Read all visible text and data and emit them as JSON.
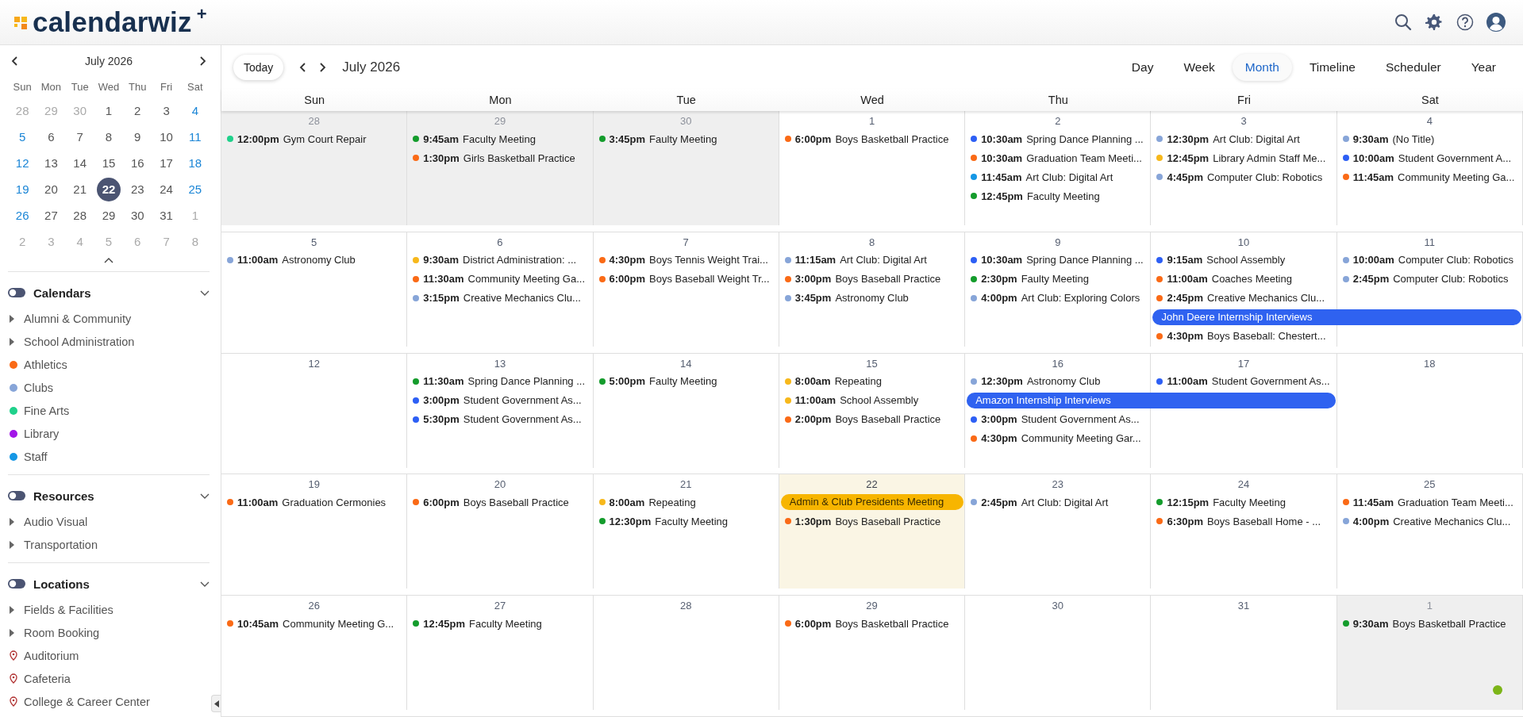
{
  "header": {
    "logo_text": "calendarwiz",
    "logo_mark": "+"
  },
  "mini_calendar": {
    "title": "July 2026",
    "weekdays": [
      "Sun",
      "Mon",
      "Tue",
      "Wed",
      "Thu",
      "Fri",
      "Sat"
    ],
    "weeks": [
      [
        {
          "label": "28",
          "muted": true,
          "selected": false
        },
        {
          "label": "29",
          "muted": true,
          "selected": false
        },
        {
          "label": "30",
          "muted": true,
          "selected": false
        },
        {
          "label": "1",
          "muted": false,
          "selected": false
        },
        {
          "label": "2",
          "muted": false,
          "selected": false
        },
        {
          "label": "3",
          "muted": false,
          "selected": false
        },
        {
          "label": "4",
          "muted": false,
          "selected": false
        }
      ],
      [
        {
          "label": "5",
          "muted": false,
          "selected": false
        },
        {
          "label": "6",
          "muted": false,
          "selected": false
        },
        {
          "label": "7",
          "muted": false,
          "selected": false
        },
        {
          "label": "8",
          "muted": false,
          "selected": false
        },
        {
          "label": "9",
          "muted": false,
          "selected": false
        },
        {
          "label": "10",
          "muted": false,
          "selected": false
        },
        {
          "label": "11",
          "muted": false,
          "selected": false
        }
      ],
      [
        {
          "label": "12",
          "muted": false,
          "selected": false
        },
        {
          "label": "13",
          "muted": false,
          "selected": false
        },
        {
          "label": "14",
          "muted": false,
          "selected": false
        },
        {
          "label": "15",
          "muted": false,
          "selected": false
        },
        {
          "label": "16",
          "muted": false,
          "selected": false
        },
        {
          "label": "17",
          "muted": false,
          "selected": false
        },
        {
          "label": "18",
          "muted": false,
          "selected": false
        }
      ],
      [
        {
          "label": "19",
          "muted": false,
          "selected": false
        },
        {
          "label": "20",
          "muted": false,
          "selected": false
        },
        {
          "label": "21",
          "muted": false,
          "selected": false
        },
        {
          "label": "22",
          "muted": false,
          "selected": true
        },
        {
          "label": "23",
          "muted": false,
          "selected": false
        },
        {
          "label": "24",
          "muted": false,
          "selected": false
        },
        {
          "label": "25",
          "muted": false,
          "selected": false
        }
      ],
      [
        {
          "label": "26",
          "muted": false,
          "selected": false
        },
        {
          "label": "27",
          "muted": false,
          "selected": false
        },
        {
          "label": "28",
          "muted": false,
          "selected": false
        },
        {
          "label": "29",
          "muted": false,
          "selected": false
        },
        {
          "label": "30",
          "muted": false,
          "selected": false
        },
        {
          "label": "31",
          "muted": false,
          "selected": false
        },
        {
          "label": "1",
          "muted": true,
          "selected": false
        }
      ],
      [
        {
          "label": "2",
          "muted": true,
          "selected": false
        },
        {
          "label": "3",
          "muted": true,
          "selected": false
        },
        {
          "label": "4",
          "muted": true,
          "selected": false
        },
        {
          "label": "5",
          "muted": true,
          "selected": false
        },
        {
          "label": "6",
          "muted": true,
          "selected": false
        },
        {
          "label": "7",
          "muted": true,
          "selected": false
        },
        {
          "label": "8",
          "muted": true,
          "selected": false
        }
      ]
    ]
  },
  "sidebar": {
    "sections": [
      {
        "title": "Calendars",
        "items": [
          {
            "kind": "group",
            "label": "Alumni & Community"
          },
          {
            "kind": "group",
            "label": "School Administration"
          },
          {
            "kind": "calendar",
            "label": "Athletics",
            "color": "#fa6a16"
          },
          {
            "kind": "calendar",
            "label": "Clubs",
            "color": "#87a5d8"
          },
          {
            "kind": "calendar",
            "label": "Fine Arts",
            "color": "#1fd18b"
          },
          {
            "kind": "calendar",
            "label": "Library",
            "color": "#a216e8"
          },
          {
            "kind": "calendar",
            "label": "Staff",
            "color": "#1597e5"
          }
        ]
      },
      {
        "title": "Resources",
        "items": [
          {
            "kind": "group",
            "label": "Audio Visual"
          },
          {
            "kind": "group",
            "label": "Transportation"
          }
        ]
      },
      {
        "title": "Locations",
        "items": [
          {
            "kind": "group",
            "label": "Fields & Facilities"
          },
          {
            "kind": "group",
            "label": "Room Booking"
          },
          {
            "kind": "location",
            "label": "Auditorium"
          },
          {
            "kind": "location",
            "label": "Cafeteria"
          },
          {
            "kind": "location",
            "label": "College & Career Center"
          }
        ]
      }
    ]
  },
  "toolbar": {
    "today_button": "Today",
    "title": "July 2026",
    "views": [
      {
        "label": "Day",
        "selected": false
      },
      {
        "label": "Week",
        "selected": false
      },
      {
        "label": "Month",
        "selected": true
      },
      {
        "label": "Timeline",
        "selected": false
      },
      {
        "label": "Scheduler",
        "selected": false
      },
      {
        "label": "Year",
        "selected": false
      }
    ]
  },
  "month": {
    "weekdays": [
      "Sun",
      "Mon",
      "Tue",
      "Wed",
      "Thu",
      "Fri",
      "Sat"
    ],
    "weeks": [
      {
        "days": [
          {
            "date": "28",
            "muted": true,
            "today": false,
            "events": [
              {
                "kind": "timed",
                "text": "**12:00pm** Gym Court Repair",
                "color": "#1fd18b"
              }
            ]
          },
          {
            "date": "29",
            "muted": true,
            "today": false,
            "events": [
              {
                "kind": "timed",
                "text": "**9:45am** Faculty Meeting",
                "color": "#149c2c"
              },
              {
                "kind": "timed",
                "text": "**1:30pm** Girls Basketball Practice",
                "color": "#fa6a16"
              }
            ]
          },
          {
            "date": "30",
            "muted": true,
            "today": false,
            "events": [
              {
                "kind": "timed",
                "text": "**3:45pm** Faulty Meeting",
                "color": "#149c2c"
              }
            ]
          },
          {
            "date": "1",
            "muted": false,
            "today": false,
            "events": [
              {
                "kind": "timed",
                "text": "**6:00pm** Boys Basketball Practice",
                "color": "#fa6a16"
              }
            ]
          },
          {
            "date": "2",
            "muted": false,
            "today": false,
            "events": [
              {
                "kind": "timed",
                "text": "**10:30am** Spring Dance Planning ...",
                "color": "#2d5ff5"
              },
              {
                "kind": "timed",
                "text": "**10:30am** Graduation Team Meeti...",
                "color": "#fa6a16"
              },
              {
                "kind": "timed",
                "text": "**11:45am** Art Club: Digital Art",
                "color": "#1597e5"
              },
              {
                "kind": "timed",
                "text": "**12:45pm** Faculty Meeting",
                "color": "#149c2c"
              }
            ]
          },
          {
            "date": "3",
            "muted": false,
            "today": false,
            "events": [
              {
                "kind": "timed",
                "text": "**12:30pm** Art Club: Digital Art",
                "color": "#87a5d8"
              },
              {
                "kind": "timed",
                "text": "**12:45pm** Library Admin Staff Me...",
                "color": "#f7b81b"
              },
              {
                "kind": "timed",
                "text": "**4:45pm** Computer Club: Robotics",
                "color": "#87a5d8"
              }
            ]
          },
          {
            "date": "4",
            "muted": false,
            "today": false,
            "events": [
              {
                "kind": "timed",
                "text": "**9:30am** (No Title)",
                "color": "#87a5d8"
              },
              {
                "kind": "timed",
                "text": "**10:00am** Student Government A...",
                "color": "#2d5ff5"
              },
              {
                "kind": "timed",
                "text": "**11:45am** Community Meeting Ga...",
                "color": "#fa6a16"
              }
            ]
          }
        ]
      },
      {
        "days": [
          {
            "date": "5",
            "muted": false,
            "today": false,
            "events": [
              {
                "kind": "timed",
                "text": "**11:00am** Astronomy Club",
                "color": "#87a5d8"
              }
            ]
          },
          {
            "date": "6",
            "muted": false,
            "today": false,
            "events": [
              {
                "kind": "timed",
                "text": "**9:30am** District Administration: ...",
                "color": "#f7b81b"
              },
              {
                "kind": "timed",
                "text": "**11:30am** Community Meeting Ga...",
                "color": "#fa6a16"
              },
              {
                "kind": "timed",
                "text": "**3:15pm** Creative Mechanics Clu...",
                "color": "#87a5d8"
              }
            ]
          },
          {
            "date": "7",
            "muted": false,
            "today": false,
            "events": [
              {
                "kind": "timed",
                "text": "**4:30pm** Boys Tennis Weight Trai...",
                "color": "#fa6a16"
              },
              {
                "kind": "timed",
                "text": "**6:00pm** Boys Baseball Weight Tr...",
                "color": "#fa6a16"
              }
            ]
          },
          {
            "date": "8",
            "muted": false,
            "today": false,
            "events": [
              {
                "kind": "timed",
                "text": "**11:15am** Art Club: Digital Art",
                "color": "#87a5d8"
              },
              {
                "kind": "timed",
                "text": "**3:00pm** Boys Baseball Practice",
                "color": "#fa6a16"
              },
              {
                "kind": "timed",
                "text": "**3:45pm** Astronomy Club",
                "color": "#87a5d8"
              }
            ]
          },
          {
            "date": "9",
            "muted": false,
            "today": false,
            "events": [
              {
                "kind": "timed",
                "text": "**10:30am** Spring Dance Planning ...",
                "color": "#2d5ff5"
              },
              {
                "kind": "timed",
                "text": "**2:30pm** Faulty Meeting",
                "color": "#149c2c"
              },
              {
                "kind": "timed",
                "text": "**4:00pm** Art Club: Exploring Colors",
                "color": "#87a5d8"
              }
            ]
          },
          {
            "date": "10",
            "muted": false,
            "today": false,
            "events": [
              {
                "kind": "timed",
                "text": "**9:15am** School Assembly",
                "color": "#2d5ff5"
              },
              {
                "kind": "timed",
                "text": "**11:00am** Coaches Meeting",
                "color": "#fa6a16"
              },
              {
                "kind": "timed",
                "text": "**2:45pm** Creative Mechanics Clu...",
                "color": "#fa6a16"
              },
              {
                "kind": "allday",
                "text": "John Deere Internship Interviews",
                "color": "#2f62f0"
              },
              {
                "kind": "timed",
                "text": "**4:30pm** Boys Baseball: Chestert...",
                "color": "#fa6a16"
              }
            ]
          },
          {
            "date": "11",
            "muted": false,
            "today": false,
            "events": [
              {
                "kind": "continued"
              },
              {
                "kind": "timed",
                "text": "**10:00am** Computer Club: Robotics",
                "color": "#87a5d8"
              },
              {
                "kind": "timed",
                "text": "**2:45pm** Computer Club: Robotics",
                "color": "#87a5d8"
              }
            ]
          }
        ]
      },
      {
        "days": [
          {
            "date": "12",
            "muted": false,
            "today": false
          },
          {
            "date": "13",
            "muted": false,
            "today": false,
            "events": [
              {
                "kind": "timed",
                "text": "**11:30am** Spring Dance Planning ...",
                "color": "#149c2c"
              },
              {
                "kind": "timed",
                "text": "**3:00pm** Student Government As...",
                "color": "#2d5ff5"
              },
              {
                "kind": "timed",
                "text": "**5:30pm** Student Government As...",
                "color": "#2d5ff5"
              }
            ]
          },
          {
            "date": "14",
            "muted": false,
            "today": false,
            "events": [
              {
                "kind": "timed",
                "text": "**5:00pm** Faulty Meeting",
                "color": "#149c2c"
              }
            ]
          },
          {
            "date": "15",
            "muted": false,
            "today": false,
            "events": [
              {
                "kind": "timed",
                "text": "**8:00am** Repeating",
                "color": "#f7b81b"
              },
              {
                "kind": "timed",
                "text": "**11:00am** School Assembly",
                "color": "#f7b81b"
              },
              {
                "kind": "timed",
                "text": "**2:00pm** Boys Baseball Practice",
                "color": "#fa6a16"
              }
            ]
          },
          {
            "date": "16",
            "muted": false,
            "today": false,
            "events": [
              {
                "kind": "timed",
                "text": "**12:30pm** Astronomy Club",
                "color": "#87a5d8"
              },
              {
                "kind": "allday",
                "text": "Amazon Internship Interviews",
                "color": "#2f62f0"
              },
              {
                "kind": "timed",
                "text": "**3:00pm** Student Government As...",
                "color": "#2d5ff5"
              },
              {
                "kind": "timed",
                "text": "**4:30pm** Community Meeting Gar...",
                "color": "#fa6a16"
              }
            ]
          },
          {
            "date": "17",
            "muted": false,
            "today": false,
            "events": [
              {
                "kind": "continued"
              },
              {
                "kind": "timed",
                "text": "**11:00am** Student Government As...",
                "color": "#2d5ff5"
              }
            ]
          },
          {
            "date": "18",
            "muted": false,
            "today": false
          }
        ]
      },
      {
        "days": [
          {
            "date": "19",
            "muted": false,
            "today": false,
            "events": [
              {
                "kind": "timed",
                "text": "**11:00am** Graduation Cermonies",
                "color": "#fa6a16"
              }
            ]
          },
          {
            "date": "20",
            "muted": false,
            "today": false,
            "events": [
              {
                "kind": "timed",
                "text": "**6:00pm** Boys Baseball Practice",
                "color": "#fa6a16"
              }
            ]
          },
          {
            "date": "21",
            "muted": false,
            "today": false,
            "events": [
              {
                "kind": "timed",
                "text": "**8:00am** Repeating",
                "color": "#f7b81b"
              },
              {
                "kind": "timed",
                "text": "**12:30pm** Faculty Meeting",
                "color": "#149c2c"
              }
            ]
          },
          {
            "date": "22",
            "muted": false,
            "today": true,
            "events": [
              {
                "kind": "allday",
                "text": "Admin & Club Presidents Meeting",
                "color": "#f7b500"
              },
              {
                "kind": "timed",
                "text": "**1:30pm** Boys Baseball Practice",
                "color": "#fa6a16"
              }
            ]
          },
          {
            "date": "23",
            "muted": false,
            "today": false,
            "events": [
              {
                "kind": "timed",
                "text": "**2:45pm** Art Club: Digital Art",
                "color": "#87a5d8"
              }
            ]
          },
          {
            "date": "24",
            "muted": false,
            "today": false,
            "events": [
              {
                "kind": "timed",
                "text": "**12:15pm** Faculty Meeting",
                "color": "#149c2c"
              },
              {
                "kind": "timed",
                "text": "**6:30pm** Boys Baseball Home - ...",
                "color": "#fa6a16"
              }
            ]
          },
          {
            "date": "25",
            "muted": false,
            "today": false,
            "events": [
              {
                "kind": "timed",
                "text": "**11:45am** Graduation Team Meeti...",
                "color": "#fa6a16"
              },
              {
                "kind": "timed",
                "text": "**4:00pm** Creative Mechanics Clu...",
                "color": "#87a5d8"
              }
            ]
          }
        ]
      },
      {
        "days": [
          {
            "date": "26",
            "muted": false,
            "today": false,
            "events": [
              {
                "kind": "timed",
                "text": "**10:45am** Community Meeting G...",
                "color": "#fa6a16"
              }
            ]
          },
          {
            "date": "27",
            "muted": false,
            "today": false,
            "events": [
              {
                "kind": "timed",
                "text": "**12:45pm** Faculty Meeting",
                "color": "#149c2c"
              }
            ]
          },
          {
            "date": "28",
            "muted": false,
            "today": false
          },
          {
            "date": "29",
            "muted": false,
            "today": false,
            "events": [
              {
                "kind": "timed",
                "text": "**6:00pm** Boys Basketball Practice",
                "color": "#fa6a16"
              }
            ]
          },
          {
            "date": "30",
            "muted": false,
            "today": false
          },
          {
            "date": "31",
            "muted": false,
            "today": false
          },
          {
            "date": "1",
            "muted": true,
            "today": false,
            "events": [
              {
                "kind": "timed",
                "text": "**9:30am** Boys Basketball Practice",
                "color": "#149c2c"
              }
            ]
          }
        ]
      }
    ]
  }
}
